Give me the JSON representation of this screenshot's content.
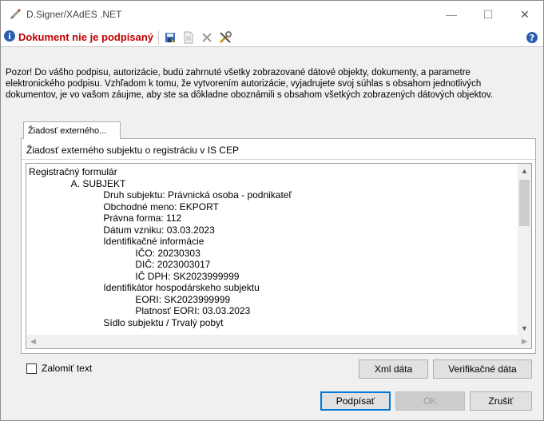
{
  "window": {
    "title": "D.Signer/XAdES .NET",
    "minimize": "—",
    "maximize": "☐",
    "close": "✕"
  },
  "toolbar": {
    "status": "Dokument nie je podpísaný"
  },
  "warning": {
    "line1": "Pozor! Do vášho podpisu, autorizácie, budú zahrnuté všetky zobrazované dátové objekty, dokumenty, a parametre",
    "line2": "elektronického podpisu. Vzhľadom k tomu, že vytvorením autorizácie, vyjadrujete svoj súhlas s obsahom jednotlivých",
    "line3": "dokumentov, je vo vašom záujme, aby ste sa dôkladne oboznámili s obsahom všetkých zobrazených dátových objektov."
  },
  "tabs": [
    {
      "label": "Žiadosť externého..."
    }
  ],
  "panel": {
    "title": "Žiadosť externého subjektu o registráciu v IS CEP",
    "lines": [
      "Registračný formulár",
      "                A. SUBJEKT",
      "                            Druh subjektu: Právnická osoba - podnikateľ",
      "                            Obchodné meno: EKPORT",
      "                            Právna forma: 112",
      "                            Dátum vzniku: 03.03.2023",
      "                            Identifikačné informácie",
      "                                        IČO: 20230303",
      "                                        DIČ: 2023003017",
      "                                        IČ DPH: SK2023999999",
      "                            Identifikátor hospodárskeho subjektu",
      "                                        EORI: SK2023999999",
      "                                        Platnosť EORI: 03.03.2023",
      "                            Sídlo subjektu / Trvalý pobyt"
    ]
  },
  "options": {
    "wrap_text_label": "Zalomiť text",
    "wrap_text_checked": false
  },
  "buttons": {
    "xml": "Xml dáta",
    "verification": "Verifikačné dáta",
    "sign": "Podpísať",
    "ok": "OK",
    "cancel": "Zrušiť"
  },
  "colors": {
    "status_text": "#c00000",
    "default_button_border": "#0078d7"
  }
}
